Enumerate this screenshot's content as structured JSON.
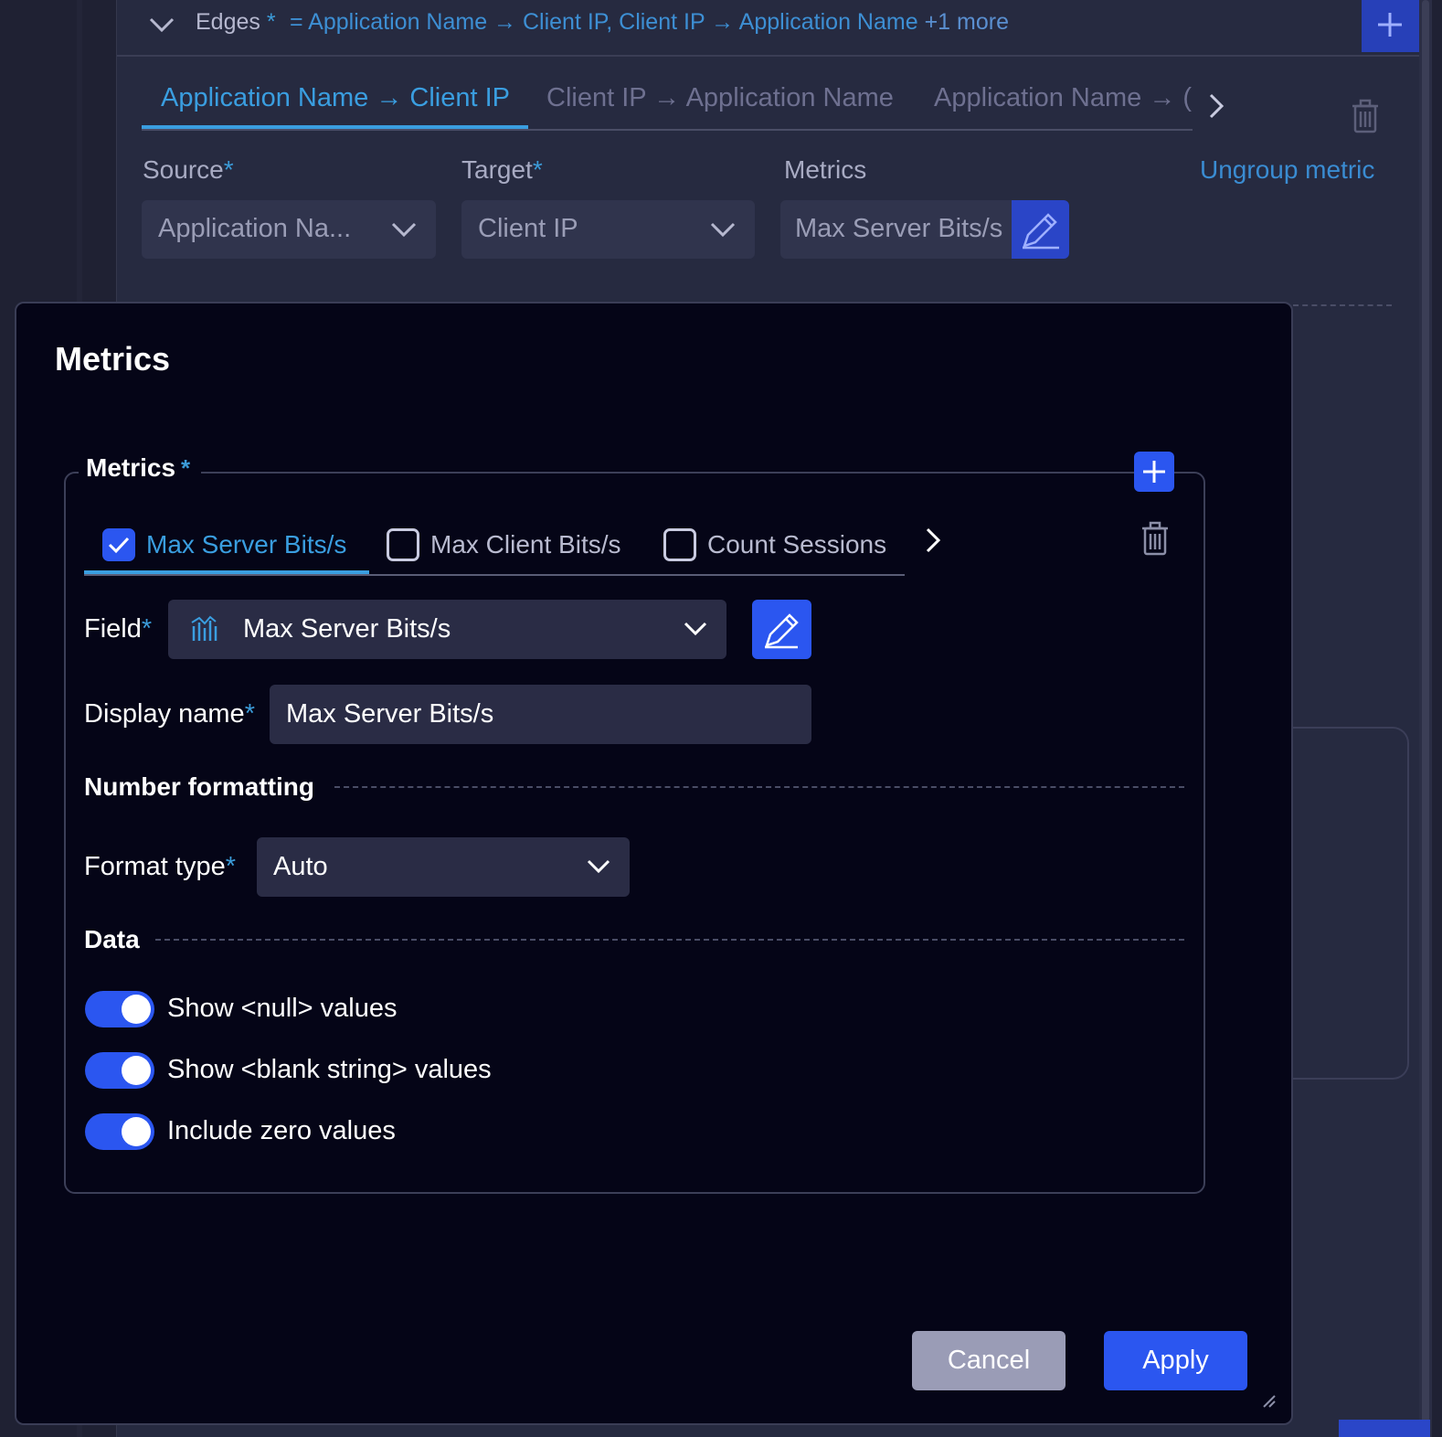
{
  "background": {
    "edges": {
      "label": "Edges",
      "required_mark": "*",
      "summary": "= Application Name → Client IP, Client IP → Application Name",
      "more": "+1 more"
    },
    "tabs": [
      {
        "label": "Application Name → Client IP",
        "active": true
      },
      {
        "label": "Client IP → Application Name",
        "active": false
      },
      {
        "label": "Application Name → (",
        "active": false
      }
    ],
    "source": {
      "label": "Source",
      "value": "Application Na..."
    },
    "target": {
      "label": "Target",
      "value": "Client IP"
    },
    "metrics": {
      "label": "Metrics",
      "value": "Max Server Bits/s"
    },
    "ungroup_link": "Ungroup metric"
  },
  "modal": {
    "title": "Metrics",
    "fieldset_legend": "Metrics",
    "required_mark": "*",
    "metric_tabs": [
      {
        "label": "Max Server Bits/s",
        "checked": true,
        "active": true
      },
      {
        "label": "Max Client Bits/s",
        "checked": false,
        "active": false
      },
      {
        "label": "Count Sessions",
        "checked": false,
        "active": false
      }
    ],
    "field": {
      "label": "Field",
      "value": "Max Server Bits/s",
      "icon": "bar-chart-icon"
    },
    "display_name": {
      "label": "Display name",
      "value": "Max Server Bits/s"
    },
    "number_formatting": {
      "heading": "Number formatting",
      "format_type": {
        "label": "Format type",
        "value": "Auto"
      }
    },
    "data": {
      "heading": "Data",
      "toggles": [
        {
          "label": "Show <null> values",
          "on": true
        },
        {
          "label": "Show <blank string> values",
          "on": true
        },
        {
          "label": "Include zero values",
          "on": true
        }
      ]
    },
    "buttons": {
      "cancel": "Cancel",
      "apply": "Apply"
    }
  },
  "colors": {
    "accent": "#2b56f0",
    "link": "#3a9ee0",
    "modal_bg": "#050517",
    "panel_bg": "#262a40"
  }
}
